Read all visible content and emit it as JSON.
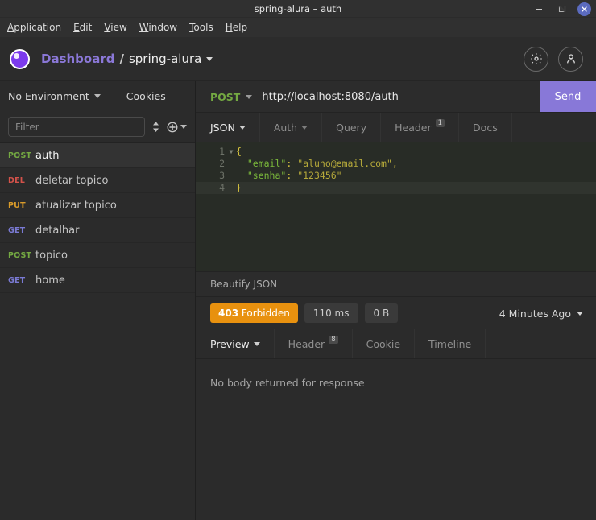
{
  "window": {
    "title": "spring-alura – auth",
    "minimize_label": "–",
    "maximize_label": "❐",
    "close_label": "✕"
  },
  "menubar": {
    "items": [
      {
        "mnemonic": "A",
        "rest": "pplication"
      },
      {
        "mnemonic": "E",
        "rest": "dit"
      },
      {
        "mnemonic": "V",
        "rest": "iew"
      },
      {
        "mnemonic": "W",
        "rest": "indow"
      },
      {
        "mnemonic": "T",
        "rest": "ools"
      },
      {
        "mnemonic": "H",
        "rest": "elp"
      }
    ]
  },
  "header": {
    "logo_name": "insomnia-logo",
    "breadcrumb_dashboard": "Dashboard",
    "breadcrumb_separator": "/",
    "breadcrumb_project": "spring-alura",
    "settings_icon": "gear-icon",
    "account_icon": "user-icon",
    "accent_purple": "#7c3aed"
  },
  "sidebar": {
    "environment_label": "No Environment",
    "cookies_label": "Cookies",
    "filter_placeholder": "Filter",
    "filter_value": "",
    "sort_icon": "sort-icon",
    "add_icon": "plus-circle-icon",
    "requests": [
      {
        "method": "POST",
        "method_class": "m-post",
        "name": "auth",
        "active": true
      },
      {
        "method": "DEL",
        "method_class": "m-del",
        "name": "deletar topico",
        "active": false
      },
      {
        "method": "PUT",
        "method_class": "m-put",
        "name": "atualizar topico",
        "active": false
      },
      {
        "method": "GET",
        "method_class": "m-get",
        "name": "detalhar",
        "active": false
      },
      {
        "method": "POST",
        "method_class": "m-post",
        "name": "topico",
        "active": false
      },
      {
        "method": "GET",
        "method_class": "m-get",
        "name": "home",
        "active": false
      }
    ]
  },
  "request": {
    "method": "POST",
    "url": "http://localhost:8080/auth",
    "send_label": "Send",
    "tabs": [
      {
        "label": "JSON",
        "active": true,
        "caret": true,
        "badge": ""
      },
      {
        "label": "Auth",
        "active": false,
        "caret": true,
        "badge": ""
      },
      {
        "label": "Query",
        "active": false,
        "caret": false,
        "badge": ""
      },
      {
        "label": "Header",
        "active": false,
        "caret": false,
        "badge": "1"
      },
      {
        "label": "Docs",
        "active": false,
        "caret": false,
        "badge": ""
      }
    ],
    "body_lines": [
      {
        "num": "1",
        "fold": "▼",
        "active": false
      },
      {
        "num": "2",
        "fold": "",
        "active": false
      },
      {
        "num": "3",
        "fold": "",
        "active": false
      },
      {
        "num": "4",
        "fold": "",
        "active": true
      }
    ],
    "body_json": {
      "email": "aluno@email.com",
      "senha": "123456"
    },
    "beautify_label": "Beautify JSON"
  },
  "response": {
    "status_code": "403",
    "status_text": "Forbidden",
    "status_color": "#e8910f",
    "time": "110 ms",
    "size": "0 B",
    "timestamp": "4 Minutes Ago",
    "tabs": [
      {
        "label": "Preview",
        "active": true,
        "caret": true,
        "badge": ""
      },
      {
        "label": "Header",
        "active": false,
        "caret": false,
        "badge": "8"
      },
      {
        "label": "Cookie",
        "active": false,
        "caret": false,
        "badge": ""
      },
      {
        "label": "Timeline",
        "active": false,
        "caret": false,
        "badge": ""
      }
    ],
    "empty_message": "No body returned for response"
  }
}
